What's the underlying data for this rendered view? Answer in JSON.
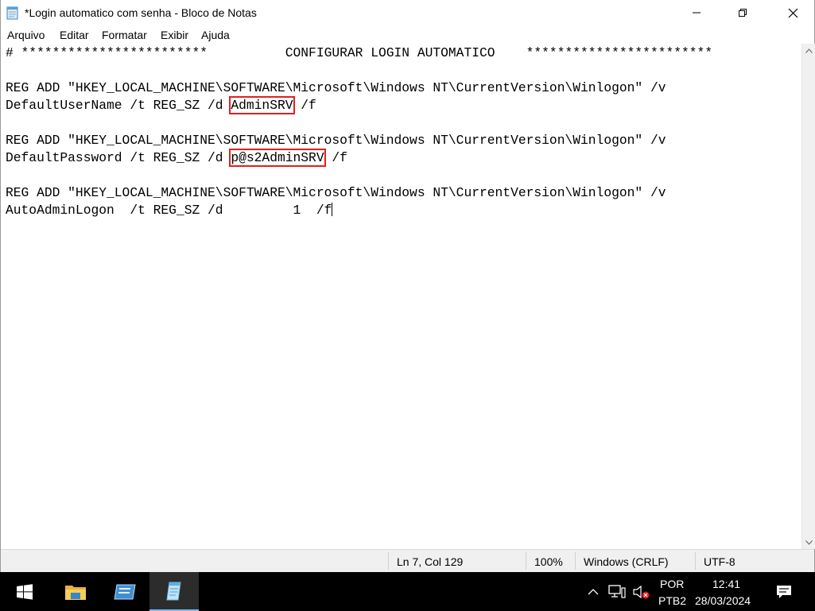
{
  "window": {
    "title": "*Login automatico com senha - Bloco de Notas"
  },
  "menu": [
    "Arquivo",
    "Editar",
    "Formatar",
    "Exibir",
    "Ajuda"
  ],
  "editor": {
    "lines": [
      "# ************************          CONFIGURAR LOGIN AUTOMATICO    ************************",
      "",
      "REG ADD \"HKEY_LOCAL_MACHINE\\SOFTWARE\\Microsoft\\Windows NT\\CurrentVersion\\Winlogon\" /v",
      "",
      "",
      "REG ADD \"HKEY_LOCAL_MACHINE\\SOFTWARE\\Microsoft\\Windows NT\\CurrentVersion\\Winlogon\" /v",
      "",
      "",
      "REG ADD \"HKEY_LOCAL_MACHINE\\SOFTWARE\\Microsoft\\Windows NT\\CurrentVersion\\Winlogon\" /v",
      "AutoAdminLogon  /t REG_SZ /d         1  /f"
    ],
    "username_prefix": "DefaultUserName /t REG_SZ /d ",
    "username_value": "AdminSRV",
    "username_suffix": " /f",
    "password_prefix": "DefaultPassword /t REG_SZ /d ",
    "password_value": "p@s2AdminSRV",
    "password_suffix": " /f",
    "highlight_color": "#e02020"
  },
  "status": {
    "position": "Ln 7, Col 129",
    "zoom": "100%",
    "line_ending": "Windows (CRLF)",
    "encoding": "UTF-8"
  },
  "tray": {
    "language": "POR",
    "keyboard": "PTB2",
    "time": "12:41",
    "date": "28/03/2024"
  },
  "icons": {
    "app": "notepad-icon",
    "start": "windows-logo-icon",
    "file_explorer": "file-explorer-icon",
    "server_manager": "server-manager-icon",
    "notepad": "notepad-icon",
    "tray_chevron": "chevron-up-icon",
    "network": "network-icon",
    "volume": "volume-muted-icon",
    "notifications": "notifications-icon"
  }
}
